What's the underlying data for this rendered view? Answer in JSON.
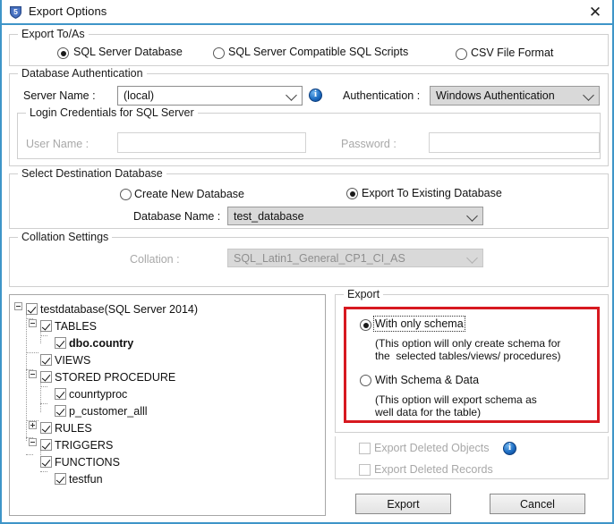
{
  "window": {
    "title": "Export Options",
    "app_icon": "shield-icon",
    "close_label": "✕",
    "border_color": "#3e95c8"
  },
  "export_to_as": {
    "legend": "Export To/As",
    "options": [
      {
        "label": "SQL Server Database",
        "selected": true
      },
      {
        "label": "SQL Server Compatible SQL Scripts",
        "selected": false
      },
      {
        "label": "CSV File Format",
        "selected": false
      }
    ]
  },
  "database_authentication": {
    "legend": "Database Authentication",
    "server_name_label": "Server Name :",
    "server_name_value": "(local)",
    "info_icon": "info-icon",
    "authentication_label": "Authentication :",
    "authentication_value": "Windows Authentication",
    "login_credentials": {
      "legend": "Login Credentials for SQL Server",
      "user_name_label": "User Name :",
      "user_name_value": "",
      "password_label": "Password :",
      "password_value": ""
    }
  },
  "destination_database": {
    "legend": "Select Destination Database",
    "options": [
      {
        "label": "Create New Database",
        "selected": false
      },
      {
        "label": "Export To Existing Database",
        "selected": true
      }
    ],
    "database_name_label": "Database Name :",
    "database_name_value": "test_database"
  },
  "collation_settings": {
    "legend": "Collation Settings",
    "collation_label": "Collation :",
    "collation_value": "SQL_Latin1_General_CP1_CI_AS"
  },
  "tree": {
    "nodes": [
      {
        "label": "testdatabase(SQL Server 2014)",
        "indent": 0,
        "checked": true,
        "bold": false,
        "expander": "minus"
      },
      {
        "label": "TABLES",
        "indent": 1,
        "checked": true,
        "bold": false,
        "expander": "minus"
      },
      {
        "label": "dbo.country",
        "indent": 2,
        "checked": true,
        "bold": true,
        "expander": "none"
      },
      {
        "label": "VIEWS",
        "indent": 1,
        "checked": true,
        "bold": false,
        "expander": "none"
      },
      {
        "label": "STORED PROCEDURE",
        "indent": 1,
        "checked": true,
        "bold": false,
        "expander": "minus"
      },
      {
        "label": "counrtyproc",
        "indent": 2,
        "checked": true,
        "bold": false,
        "expander": "none"
      },
      {
        "label": "p_customer_alll",
        "indent": 2,
        "checked": true,
        "bold": false,
        "expander": "none"
      },
      {
        "label": "RULES",
        "indent": 1,
        "checked": true,
        "bold": false,
        "expander": "none"
      },
      {
        "label": "TRIGGERS",
        "indent": 1,
        "checked": true,
        "bold": false,
        "expander": "plus"
      },
      {
        "label": "FUNCTIONS",
        "indent": 1,
        "checked": true,
        "bold": false,
        "expander": "minus"
      },
      {
        "label": "testfun",
        "indent": 2,
        "checked": true,
        "bold": false,
        "expander": "none"
      }
    ]
  },
  "export_panel": {
    "legend": "Export",
    "highlight_color": "#d71920",
    "option_schema_label": "With only schema",
    "option_schema_selected": true,
    "option_schema_desc": "(This option will only create schema for\nthe  selected tables/views/ procedures)",
    "option_schema_data_label": "With Schema & Data",
    "option_schema_data_selected": false,
    "option_schema_data_desc": "(This option will export schema as\nwell data for the table)"
  },
  "deleted_options": {
    "export_deleted_objects_label": "Export Deleted Objects",
    "export_deleted_objects_checked": false,
    "export_deleted_records_label": "Export Deleted Records",
    "export_deleted_records_checked": false,
    "info_icon": "info-icon"
  },
  "footer": {
    "export_label": "Export",
    "cancel_label": "Cancel"
  }
}
